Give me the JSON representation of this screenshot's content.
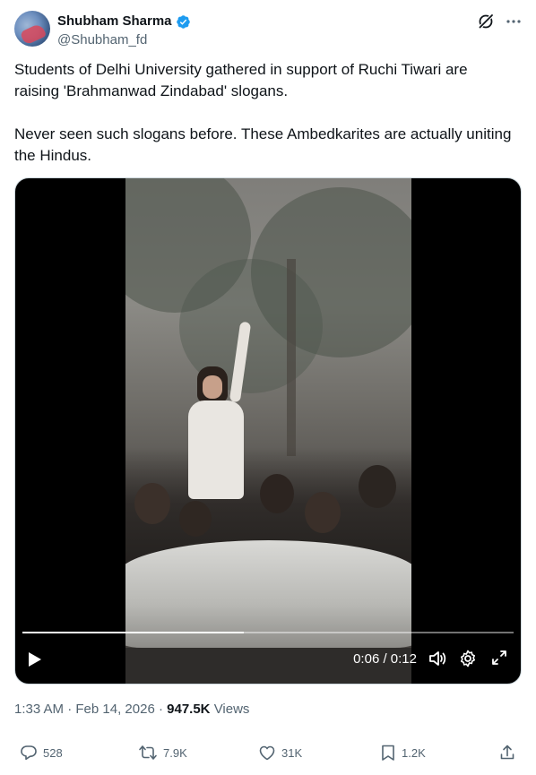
{
  "author": {
    "name": "Shubham Sharma",
    "handle": "@Shubham_fd",
    "verified": true
  },
  "tweet": {
    "paragraphs": [
      "Students of Delhi University gathered in support of Ruchi Tiwari are raising 'Brahmanwad Zindabad' slogans.",
      "Never seen such slogans before. These Ambedkarites are actually uniting the Hindus."
    ]
  },
  "video": {
    "time_display": "0:06 / 0:12",
    "progress_fraction": 0.45
  },
  "meta": {
    "time": "1:33 AM",
    "date": "Feb 14, 2026",
    "views_count": "947.5K",
    "views_label": "Views"
  },
  "actions": {
    "replies": "528",
    "reposts": "7.9K",
    "likes": "31K",
    "bookmarks": "1.2K"
  },
  "colors": {
    "verified_blue": "#1d9bf0",
    "text_primary": "#0f1419",
    "text_secondary": "#536471"
  },
  "icons": [
    "verified-badge-icon",
    "grok-icon",
    "more-icon",
    "play-icon",
    "volume-icon",
    "settings-icon",
    "fullscreen-icon",
    "reply-icon",
    "repost-icon",
    "like-icon",
    "bookmark-icon",
    "share-icon"
  ]
}
